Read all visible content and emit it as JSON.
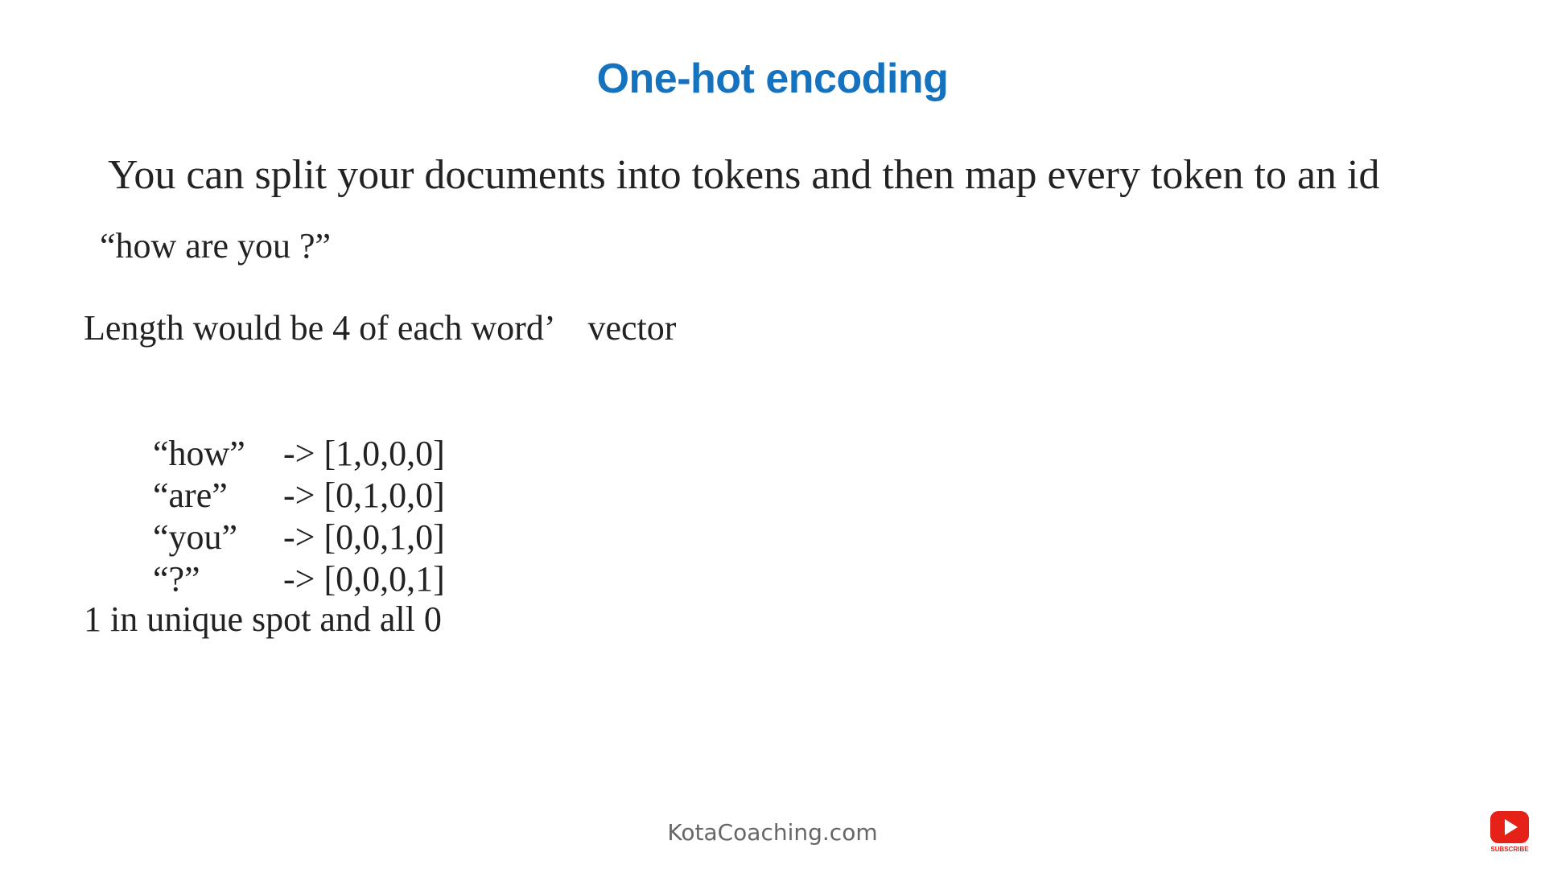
{
  "slide": {
    "title": "One-hot encoding",
    "intro": "You can split your documents into tokens and then map every token to an id",
    "example_sentence": "“how are you ?”",
    "length_note": "Length would be 4 of each word’",
    "length_note_suffix": "vector",
    "mappings": [
      {
        "token": "“how”",
        "vector": "-> [1,0,0,0]"
      },
      {
        "token": "“are”",
        "vector": "-> [0,1,0,0]"
      },
      {
        "token": "“you”",
        "vector": "-> [0,0,1,0]"
      },
      {
        "token": "“?”",
        "vector": "-> [0,0,0,1]"
      }
    ],
    "summary": "1 in unique spot and all 0",
    "footer": "KotaCoaching.com"
  },
  "subscribe_button": {
    "label": "SUBSCRIBE",
    "icon": "youtube-play-icon",
    "color": "#e62117"
  },
  "colors": {
    "title": "#1472bf",
    "body_text": "#222222",
    "footer_text": "#666666"
  }
}
